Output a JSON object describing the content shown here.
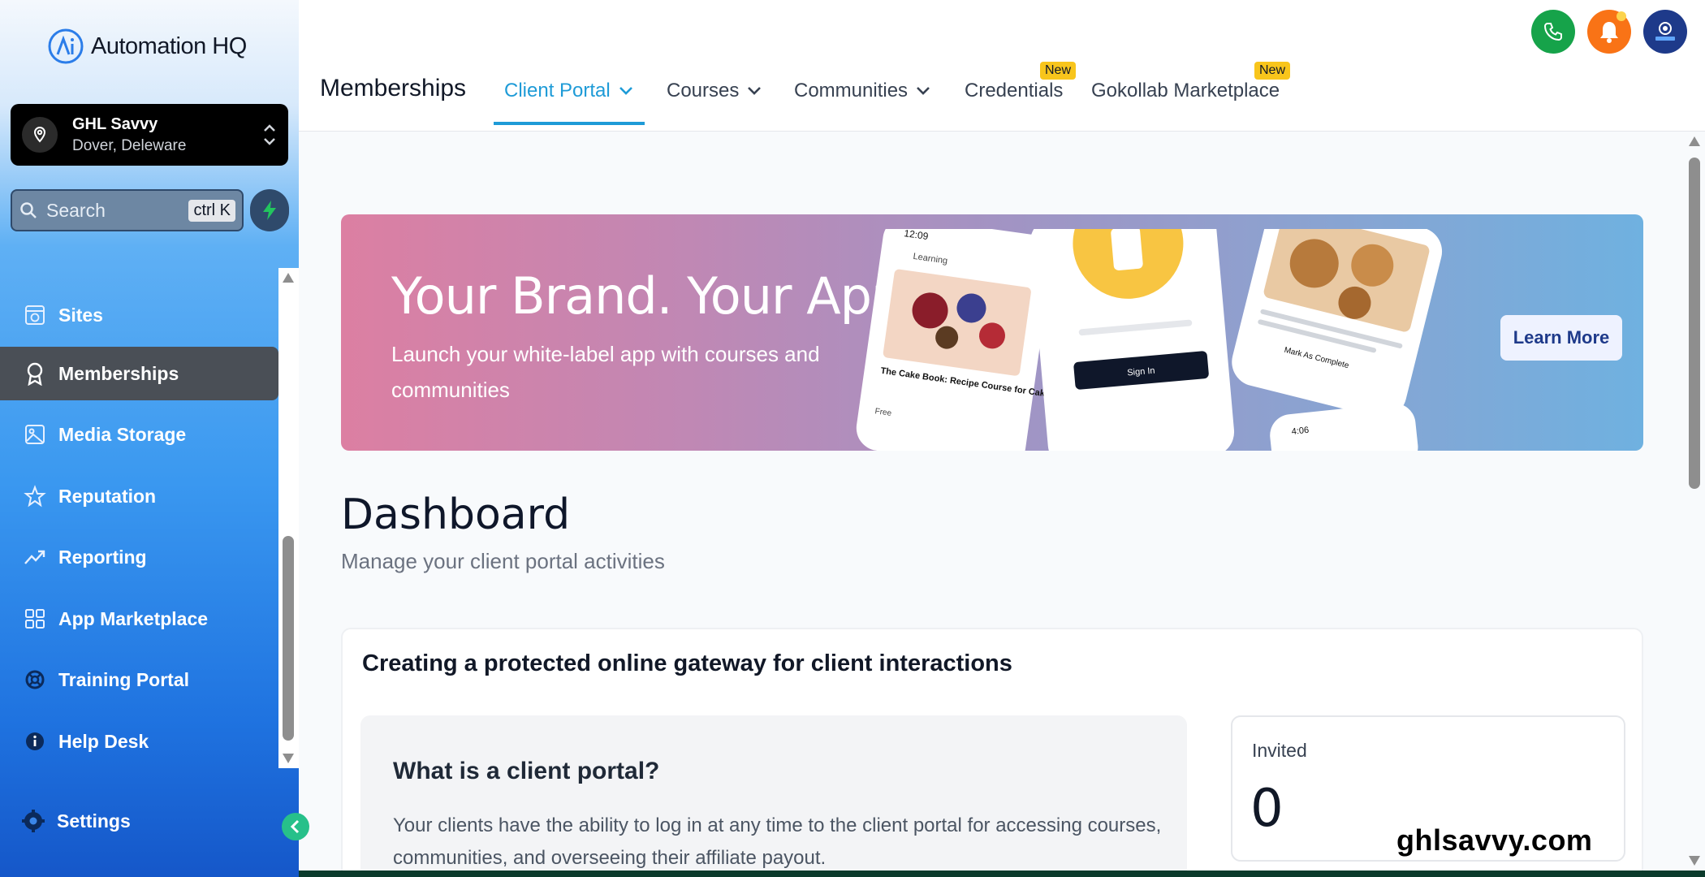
{
  "app": {
    "name": "Automation HQ"
  },
  "location": {
    "name": "GHL Savvy",
    "address": "Dover, Deleware"
  },
  "search": {
    "placeholder": "Search",
    "shortcut": "ctrl K"
  },
  "sidebar": {
    "items": [
      {
        "label": "Sites",
        "icon": "sites-icon"
      },
      {
        "label": "Memberships",
        "icon": "award-icon",
        "active": true
      },
      {
        "label": "Media Storage",
        "icon": "image-icon"
      },
      {
        "label": "Reputation",
        "icon": "star-icon"
      },
      {
        "label": "Reporting",
        "icon": "trending-up-icon"
      },
      {
        "label": "App Marketplace",
        "icon": "grid-icon"
      },
      {
        "label": "Training Portal",
        "icon": "lifebuoy-icon"
      },
      {
        "label": "Help Desk",
        "icon": "info-icon"
      }
    ],
    "settings_label": "Settings"
  },
  "topbar": {
    "title": "Memberships",
    "tabs": [
      {
        "label": "Client Portal",
        "active": true,
        "dropdown": true
      },
      {
        "label": "Courses",
        "dropdown": true
      },
      {
        "label": "Communities",
        "dropdown": true
      },
      {
        "label": "Credentials",
        "badge": "New"
      },
      {
        "label": "Gokollab Marketplace",
        "badge": "New"
      }
    ]
  },
  "banner": {
    "title": "Your Brand. Your App.",
    "subtitle": "Launch your white-label app with courses and communities",
    "cta": "Learn More",
    "mock": {
      "time1": "12:09",
      "learning": "Learning",
      "cake_title": "The Cake Book: Recipe Course for Cakes",
      "free": "Free",
      "sign_in": "Sign In",
      "mark_complete": "Mark As Complete",
      "time2": "4:06"
    }
  },
  "dashboard": {
    "title": "Dashboard",
    "subtitle": "Manage your client portal activities"
  },
  "card": {
    "title": "Creating a protected online gateway for client interactions",
    "info_title": "What is a client portal?",
    "info_body": "Your clients have the ability to log in at any time to the client portal for accessing courses, communities, and overseeing their affiliate payout.",
    "stat_label": "Invited",
    "stat_value": "0"
  },
  "watermark": "ghlsavvy.com",
  "colors": {
    "accent": "#1e9bd7",
    "phone_btn": "#16a34a",
    "bell_btn": "#f97316",
    "badge": "#f8c51c"
  }
}
